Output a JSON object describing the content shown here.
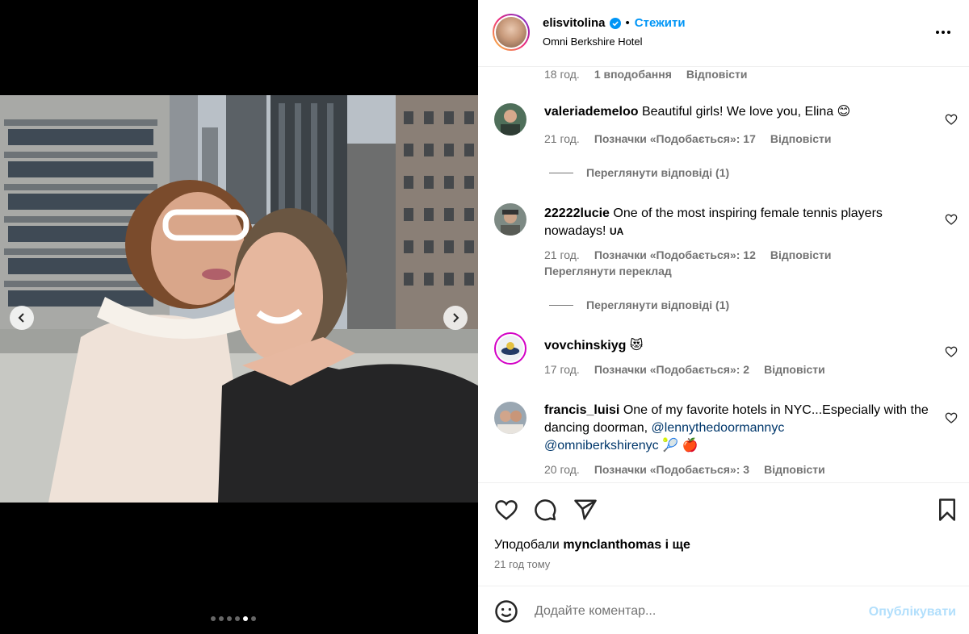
{
  "colors": {
    "accent": "#0095f6",
    "muted": "#737373",
    "mention": "#00376b",
    "publish_disabled": "#b2dffc"
  },
  "media": {
    "carousel": {
      "count": 6,
      "active_index": 4
    }
  },
  "header": {
    "username": "elisvitolina",
    "verified": true,
    "bullet": "•",
    "follow_label": "Стежити",
    "location": "Omni Berkshire Hotel"
  },
  "top_meta": {
    "time": "18 год.",
    "likes": "1 вподобання",
    "reply": "Відповісти"
  },
  "comments": [
    {
      "username": "valeriademeloo",
      "text": "Beautiful girls! We love you, Elina 😊",
      "time": "21 год.",
      "likes": "Позначки «Подобається»: 17",
      "reply": "Відповісти",
      "view_replies": "Переглянути відповіді (1)"
    },
    {
      "username": "22222lucie",
      "text": "One of the most inspiring female tennis players nowadays!",
      "flag": "UA",
      "time": "21 год.",
      "likes": "Позначки «Подобається»: 12",
      "reply": "Відповісти",
      "translate": "Переглянути переклад",
      "view_replies": "Переглянути відповіді (1)"
    },
    {
      "username": "vovchinskiyg",
      "text": "😻",
      "time": "17 год.",
      "likes": "Позначки «Подобається»: 2",
      "reply": "Відповісти"
    },
    {
      "username": "francis_luisi",
      "text": "One of my favorite hotels in NYC...Especially with the dancing doorman,",
      "mention1": "@lennythedoormannyc",
      "mention2": "@omniberkshirenyc",
      "emoji": "🎾 🍎",
      "time": "20 год.",
      "likes": "Позначки «Подобається»: 3",
      "reply": "Відповісти"
    }
  ],
  "actions": {
    "liked_by_prefix": "Уподобали",
    "liked_by_user": "mynclanthomas",
    "liked_by_suffix": "і ще",
    "time_ago": "21 год тому"
  },
  "composer": {
    "placeholder": "Додайте коментар...",
    "publish_label": "Опублікувати"
  },
  "icons": [
    "heart-icon",
    "comment-icon",
    "share-icon",
    "bookmark-icon",
    "emoji-icon",
    "more-icon",
    "verified-icon",
    "chevron-left-icon",
    "chevron-right-icon"
  ]
}
